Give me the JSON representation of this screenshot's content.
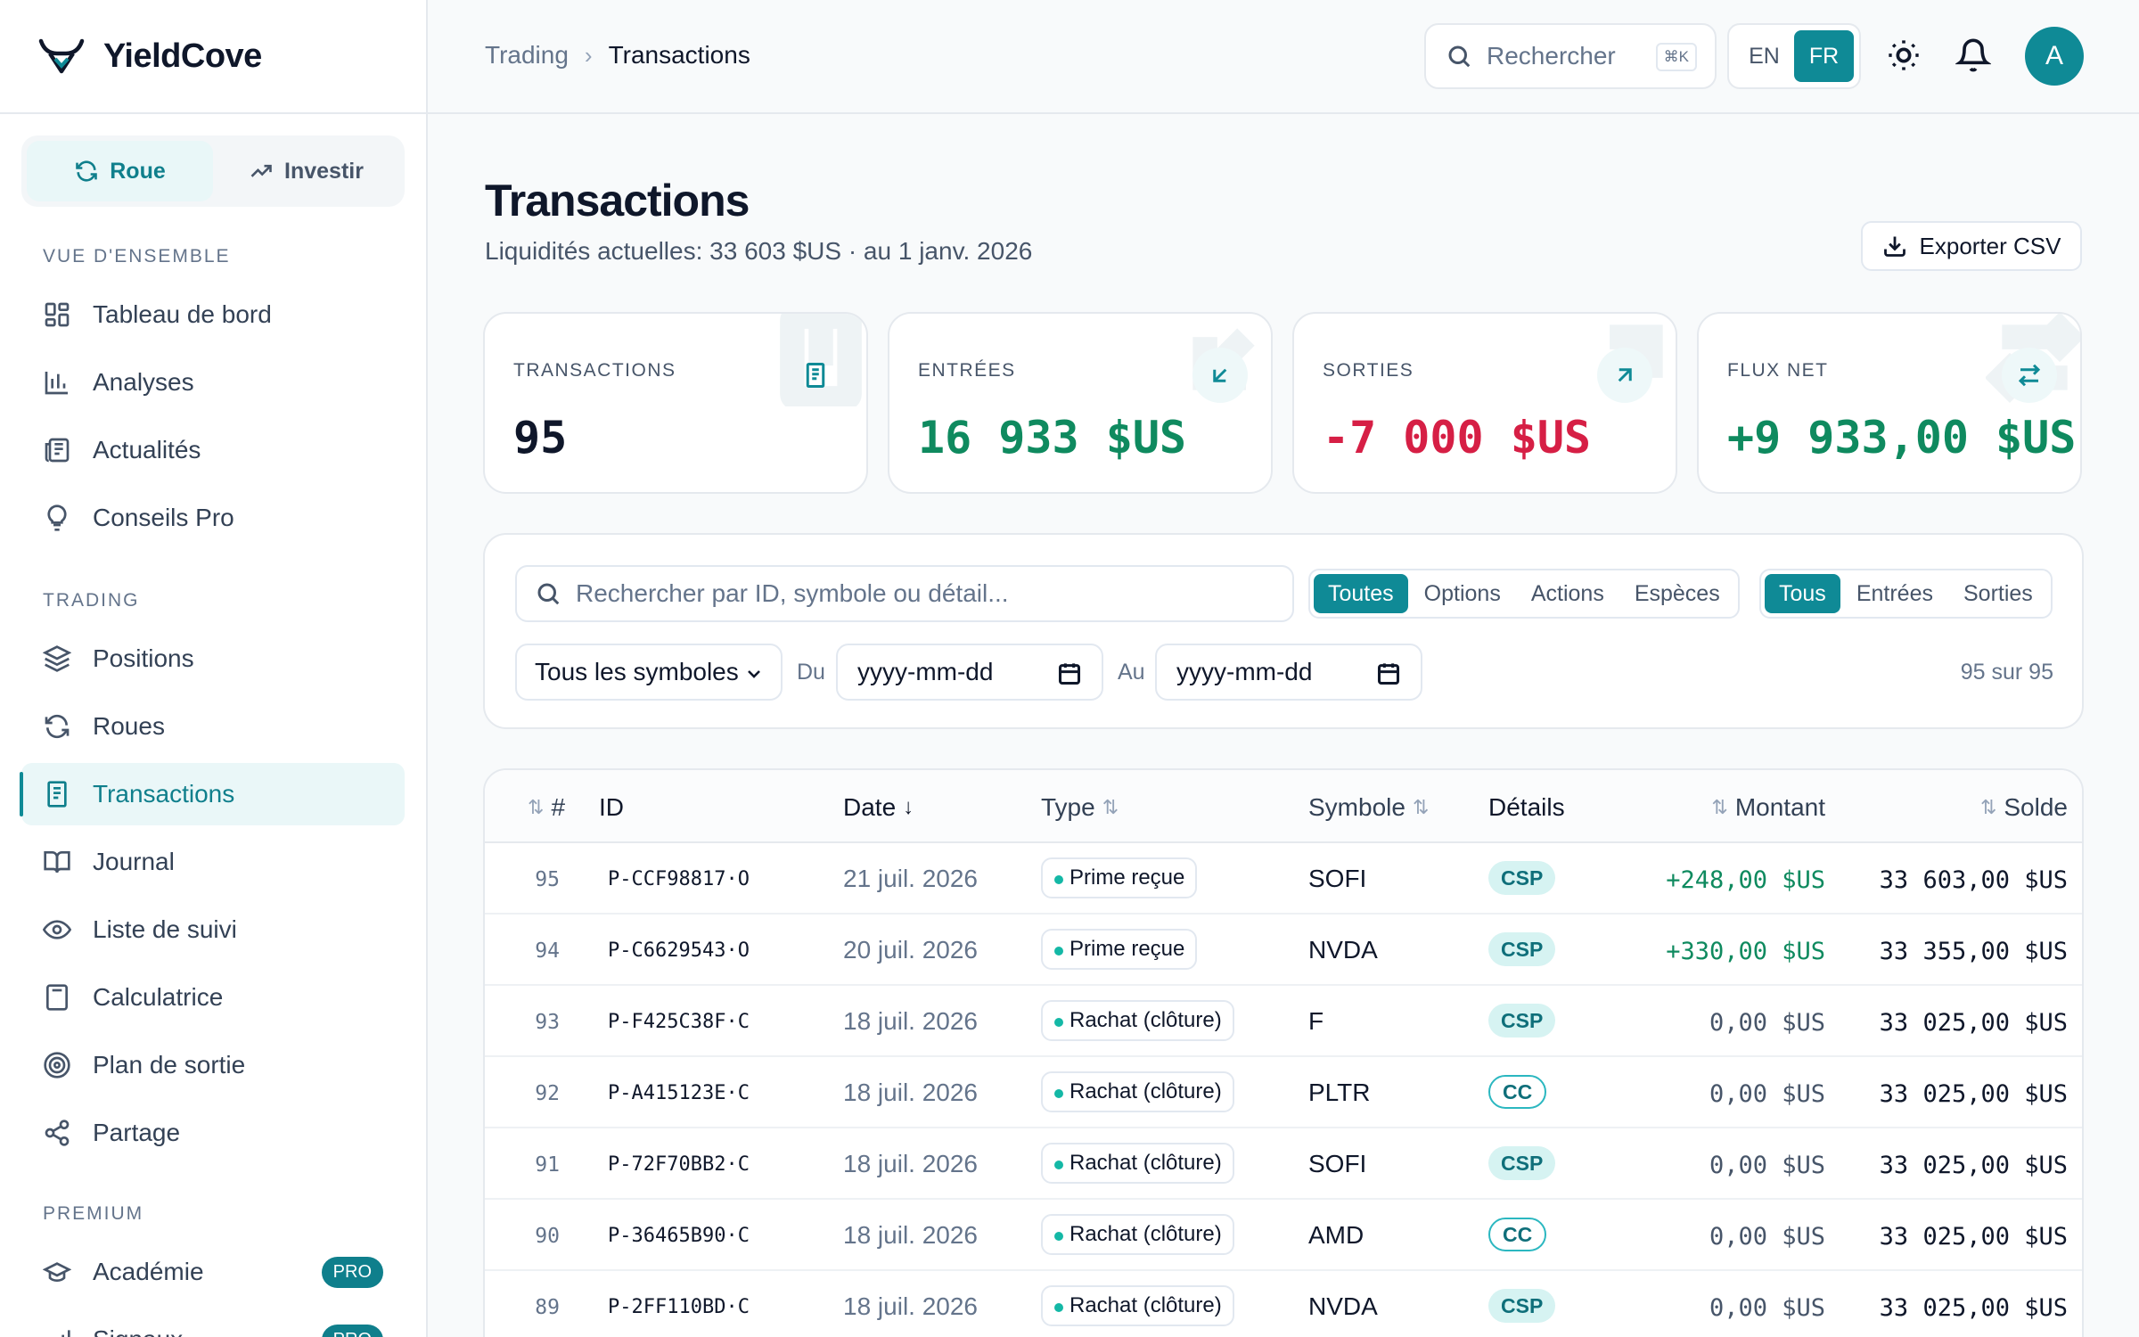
{
  "brand": {
    "name": "YieldCove"
  },
  "mode": {
    "tabs": [
      "Roue",
      "Investir"
    ],
    "active": 0
  },
  "sidebar": {
    "sections": {
      "overview": "VUE D'ENSEMBLE",
      "trading": "TRADING",
      "premium": "PREMIUM"
    },
    "items": [
      {
        "label": "Tableau de bord",
        "icon": "grid-icon"
      },
      {
        "label": "Analyses",
        "icon": "bar-chart-icon"
      },
      {
        "label": "Actualités",
        "icon": "newspaper-icon"
      },
      {
        "label": "Conseils Pro",
        "icon": "lightbulb-icon"
      },
      {
        "label": "Positions",
        "icon": "layers-icon"
      },
      {
        "label": "Roues",
        "icon": "refresh-icon"
      },
      {
        "label": "Transactions",
        "icon": "receipt-icon",
        "active": true
      },
      {
        "label": "Journal",
        "icon": "book-icon"
      },
      {
        "label": "Liste de suivi",
        "icon": "eye-icon"
      },
      {
        "label": "Calculatrice",
        "icon": "calculator-icon"
      },
      {
        "label": "Plan de sortie",
        "icon": "target-icon"
      },
      {
        "label": "Partage",
        "icon": "share-icon"
      },
      {
        "label": "Académie",
        "icon": "graduation-cap-icon",
        "badge": "PRO"
      },
      {
        "label": "Signaux",
        "icon": "signal-icon",
        "badge": "PRO"
      }
    ]
  },
  "header": {
    "breadcrumb": [
      "Trading",
      "Transactions"
    ],
    "search_placeholder": "Rechercher",
    "search_shortcut": "⌘K",
    "languages": [
      "EN",
      "FR"
    ],
    "active_language": "FR",
    "avatar_initial": "A"
  },
  "page": {
    "title": "Transactions",
    "subtitle": "Liquidités actuelles: 33 603 $US · au 1 janv. 2026",
    "export_label": "Exporter CSV"
  },
  "stats": [
    {
      "label": "TRANSACTIONS",
      "value": "95",
      "color": "#0f172a",
      "icon": "receipt-icon"
    },
    {
      "label": "ENTRÉES",
      "value": "16 933 $US",
      "color": "#0f8a5f",
      "icon": "arrow-down-left-icon"
    },
    {
      "label": "SORTIES",
      "value": "-7 000 $US",
      "color": "#d61f45",
      "icon": "arrow-up-right-icon"
    },
    {
      "label": "FLUX NET",
      "value": "+9 933,00 $US",
      "color": "#0f8a5f",
      "icon": "arrows-swap-icon"
    }
  ],
  "filters": {
    "search_placeholder": "Rechercher par ID, symbole ou détail...",
    "category_tabs": [
      "Toutes",
      "Options",
      "Actions",
      "Espèces"
    ],
    "category_active": 0,
    "flow_tabs": [
      "Tous",
      "Entrées",
      "Sorties"
    ],
    "flow_active": 0,
    "symbol_select": "Tous les symboles",
    "from_label": "Du",
    "to_label": "Au",
    "date_placeholder": "yyyy-mm-dd",
    "count": "95 sur 95"
  },
  "table": {
    "columns": [
      "#",
      "ID",
      "Date",
      "Type",
      "Symbole",
      "Détails",
      "Montant",
      "Solde"
    ],
    "rows": [
      {
        "num": "95",
        "id": "P-CCF98817·O",
        "date": "21 juil. 2026",
        "type": "Prime reçue",
        "symbol": "SOFI",
        "details": "CSP",
        "amount": "+248,00 $US",
        "balance": "33 603,00 $US"
      },
      {
        "num": "94",
        "id": "P-C6629543·O",
        "date": "20 juil. 2026",
        "type": "Prime reçue",
        "symbol": "NVDA",
        "details": "CSP",
        "amount": "+330,00 $US",
        "balance": "33 355,00 $US"
      },
      {
        "num": "93",
        "id": "P-F425C38F·C",
        "date": "18 juil. 2026",
        "type": "Rachat (clôture)",
        "symbol": "F",
        "details": "CSP",
        "amount": "0,00 $US",
        "balance": "33 025,00 $US"
      },
      {
        "num": "92",
        "id": "P-A415123E·C",
        "date": "18 juil. 2026",
        "type": "Rachat (clôture)",
        "symbol": "PLTR",
        "details": "CC",
        "amount": "0,00 $US",
        "balance": "33 025,00 $US"
      },
      {
        "num": "91",
        "id": "P-72F70BB2·C",
        "date": "18 juil. 2026",
        "type": "Rachat (clôture)",
        "symbol": "SOFI",
        "details": "CSP",
        "amount": "0,00 $US",
        "balance": "33 025,00 $US"
      },
      {
        "num": "90",
        "id": "P-36465B90·C",
        "date": "18 juil. 2026",
        "type": "Rachat (clôture)",
        "symbol": "AMD",
        "details": "CC",
        "amount": "0,00 $US",
        "balance": "33 025,00 $US"
      },
      {
        "num": "89",
        "id": "P-2FF110BD·C",
        "date": "18 juil. 2026",
        "type": "Rachat (clôture)",
        "symbol": "NVDA",
        "details": "CSP",
        "amount": "0,00 $US",
        "balance": "33 025,00 $US"
      }
    ]
  }
}
